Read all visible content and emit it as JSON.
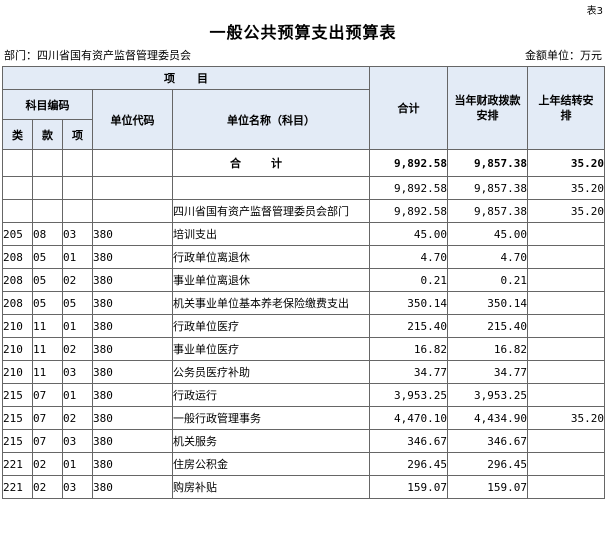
{
  "header": {
    "corner_label": "表3",
    "title": "一般公共预算支出预算表",
    "department": "部门：四川省国有资产监督管理委员会",
    "unit": "金额单位：万元"
  },
  "columns": {
    "item": "项　　目",
    "subject_code": "科目编码",
    "lei": "类",
    "kuan": "款",
    "xiang": "项",
    "unit_code": "单位代码",
    "unit_name": "单位名称（科目）",
    "total": "合计",
    "current_year": "当年财政拨款安排",
    "carryover": "上年结转安排"
  },
  "summary": {
    "label": "合计",
    "total": "9,892.58",
    "current": "9,857.38",
    "carry": "35.20"
  },
  "subtotal": {
    "total": "9,892.58",
    "current": "9,857.38",
    "carry": "35.20"
  },
  "department_row": {
    "name": "四川省国有资产监督管理委员会部门",
    "total": "9,892.58",
    "current": "9,857.38",
    "carry": "35.20"
  },
  "rows": [
    {
      "lei": "205",
      "kuan": "08",
      "xiang": "03",
      "unit": "380",
      "name": "培训支出",
      "total": "45.00",
      "current": "45.00",
      "carry": ""
    },
    {
      "lei": "208",
      "kuan": "05",
      "xiang": "01",
      "unit": "380",
      "name": "行政单位离退休",
      "total": "4.70",
      "current": "4.70",
      "carry": ""
    },
    {
      "lei": "208",
      "kuan": "05",
      "xiang": "02",
      "unit": "380",
      "name": "事业单位离退休",
      "total": "0.21",
      "current": "0.21",
      "carry": ""
    },
    {
      "lei": "208",
      "kuan": "05",
      "xiang": "05",
      "unit": "380",
      "name": "机关事业单位基本养老保险缴费支出",
      "total": "350.14",
      "current": "350.14",
      "carry": ""
    },
    {
      "lei": "210",
      "kuan": "11",
      "xiang": "01",
      "unit": "380",
      "name": "行政单位医疗",
      "total": "215.40",
      "current": "215.40",
      "carry": ""
    },
    {
      "lei": "210",
      "kuan": "11",
      "xiang": "02",
      "unit": "380",
      "name": "事业单位医疗",
      "total": "16.82",
      "current": "16.82",
      "carry": ""
    },
    {
      "lei": "210",
      "kuan": "11",
      "xiang": "03",
      "unit": "380",
      "name": "公务员医疗补助",
      "total": "34.77",
      "current": "34.77",
      "carry": ""
    },
    {
      "lei": "215",
      "kuan": "07",
      "xiang": "01",
      "unit": "380",
      "name": "行政运行",
      "total": "3,953.25",
      "current": "3,953.25",
      "carry": ""
    },
    {
      "lei": "215",
      "kuan": "07",
      "xiang": "02",
      "unit": "380",
      "name": "一般行政管理事务",
      "total": "4,470.10",
      "current": "4,434.90",
      "carry": "35.20"
    },
    {
      "lei": "215",
      "kuan": "07",
      "xiang": "03",
      "unit": "380",
      "name": "机关服务",
      "total": "346.67",
      "current": "346.67",
      "carry": ""
    },
    {
      "lei": "221",
      "kuan": "02",
      "xiang": "01",
      "unit": "380",
      "name": "住房公积金",
      "total": "296.45",
      "current": "296.45",
      "carry": ""
    },
    {
      "lei": "221",
      "kuan": "02",
      "xiang": "03",
      "unit": "380",
      "name": "购房补贴",
      "total": "159.07",
      "current": "159.07",
      "carry": ""
    }
  ]
}
